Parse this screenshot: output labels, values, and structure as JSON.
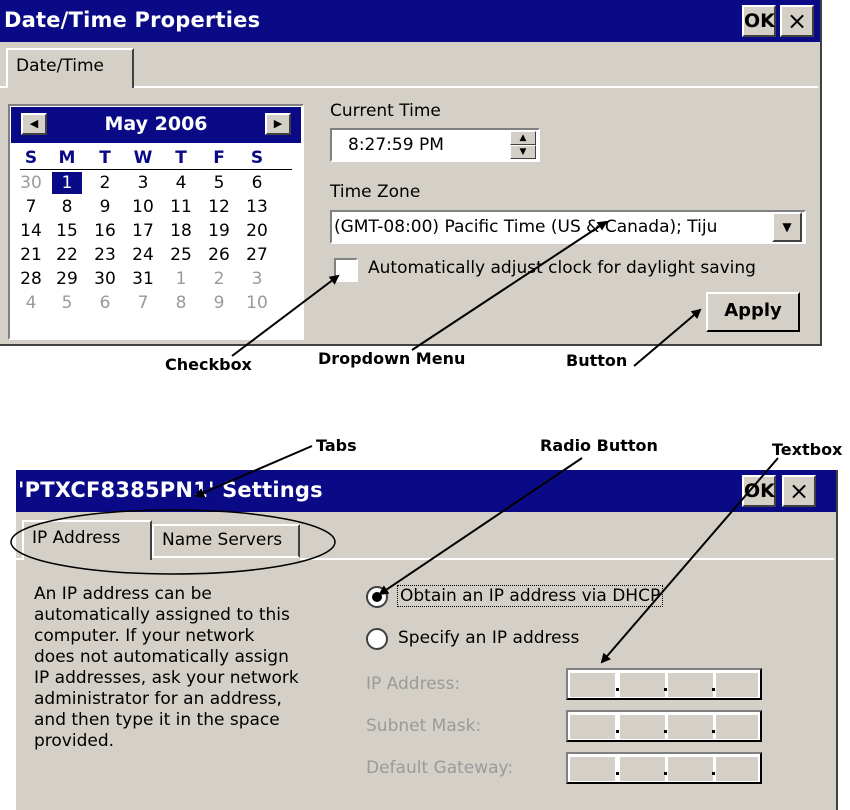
{
  "dialog1": {
    "title": "Date/Time Properties",
    "ok_label": "OK",
    "close_label": "×",
    "tab": "Date/Time",
    "calendar": {
      "month_year": "May 2006",
      "prev_arrow": "◀",
      "next_arrow": "▶",
      "weekdays": [
        "S",
        "M",
        "T",
        "W",
        "T",
        "F",
        "S"
      ],
      "weeks": [
        [
          "30",
          "1",
          "2",
          "3",
          "4",
          "5",
          "6"
        ],
        [
          "7",
          "8",
          "9",
          "10",
          "11",
          "12",
          "13"
        ],
        [
          "14",
          "15",
          "16",
          "17",
          "18",
          "19",
          "20"
        ],
        [
          "21",
          "22",
          "23",
          "24",
          "25",
          "26",
          "27"
        ],
        [
          "28",
          "29",
          "30",
          "31",
          "1",
          "2",
          "3"
        ],
        [
          "4",
          "5",
          "6",
          "7",
          "8",
          "9",
          "10"
        ]
      ],
      "selected": "1"
    },
    "current_time_label": "Current Time",
    "current_time_value": "8:27:59 PM",
    "time_zone_label": "Time Zone",
    "time_zone_value": "(GMT-08:00) Pacific Time (US & Canada); Tiju",
    "dst_checkbox_label": "Automatically adjust clock for daylight saving",
    "dst_checked": false,
    "apply_label": "Apply"
  },
  "dialog2": {
    "title": "'PTXCF8385PN1' Settings",
    "ok_label": "OK",
    "close_label": "×",
    "tabs": [
      "IP Address",
      "Name Servers"
    ],
    "description": [
      "An IP address can be",
      "automatically assigned to this",
      "computer.  If your network",
      "does not automatically assign",
      "IP addresses, ask your network",
      "administrator for an address,",
      "and then type it in the space",
      "provided."
    ],
    "radio_dhcp_label": "Obtain an IP address via DHCP",
    "radio_specify_label": "Specify an IP address",
    "selected_radio": "dhcp",
    "fields": {
      "ip_address_label": "IP Address:",
      "subnet_mask_label": "Subnet Mask:",
      "default_gateway_label": "Default Gateway:"
    }
  },
  "annotations": {
    "checkbox": "Checkbox",
    "dropdown_menu": "Dropdown Menu",
    "button": "Button",
    "tabs": "Tabs",
    "radio_button": "Radio Button",
    "textbox": "Textbox"
  }
}
